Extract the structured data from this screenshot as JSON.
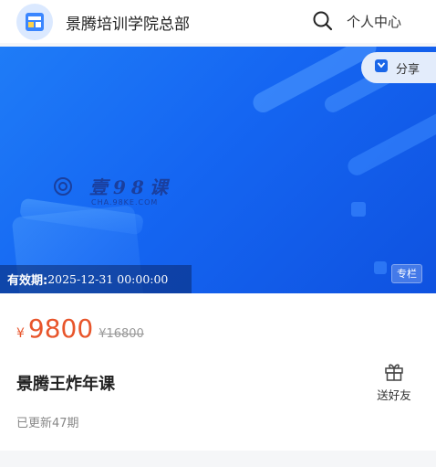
{
  "header": {
    "shop_name": "景腾培训学院总部",
    "user_center_label": "个人中心",
    "logo_icon": "school-logo-icon",
    "search_icon": "search-icon"
  },
  "banner": {
    "watermark_text": "壹98课",
    "watermark_sub": "CHA.98KE.COM",
    "share_label": "分享",
    "validity_label": "有效期:",
    "validity_value": "2025-12-31 00:00:00",
    "tag_label": "专栏",
    "colors": {
      "bg_start": "#1f7cf7",
      "bg_end": "#0f52e0"
    }
  },
  "course": {
    "currency": "¥",
    "price": "9800",
    "original_price": "¥16800",
    "title": "景腾王炸年课",
    "updated_text": "已更新47期",
    "gift_label": "送好友",
    "price_color": "#e8552b"
  }
}
